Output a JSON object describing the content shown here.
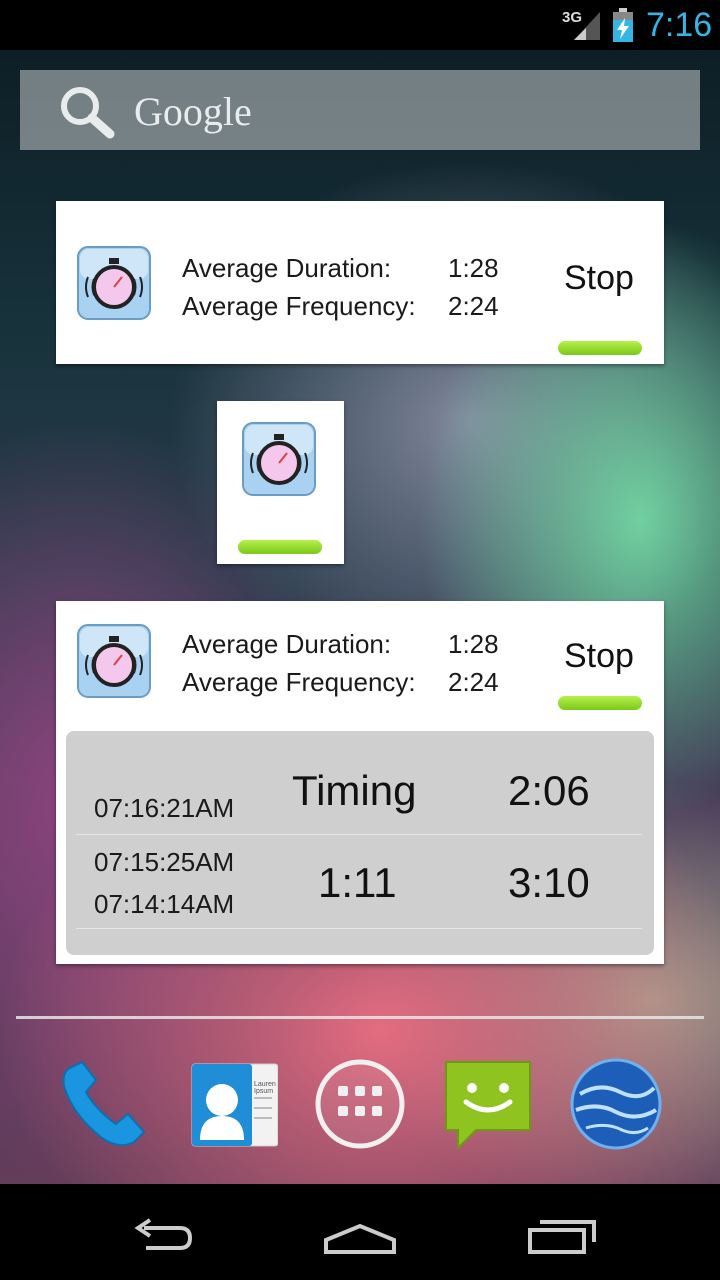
{
  "status_bar": {
    "network": "3G",
    "time": "7:16",
    "icons": [
      "signal-icon",
      "battery-charging-icon"
    ]
  },
  "search": {
    "label": "Google",
    "icon": "search-icon"
  },
  "widget_large": {
    "icon": "stopwatch-icon",
    "duration_label": "Average Duration:",
    "duration_value": "1:28",
    "frequency_label": "Average Frequency:",
    "frequency_value": "2:24",
    "stop_label": "Stop"
  },
  "widget_small": {
    "icon": "stopwatch-icon"
  },
  "widget_expanded": {
    "icon": "stopwatch-icon",
    "duration_label": "Average Duration:",
    "duration_value": "1:28",
    "frequency_label": "Average Frequency:",
    "frequency_value": "2:24",
    "stop_label": "Stop",
    "log": [
      {
        "time": "07:16:21AM",
        "duration": "Timing",
        "frequency": "2:06"
      },
      {
        "time_start": "07:15:25AM",
        "time_end": "07:14:14AM",
        "duration": "1:11",
        "frequency": "3:10"
      }
    ]
  },
  "dock": {
    "items": [
      "phone-icon",
      "contacts-icon",
      "app-drawer-icon",
      "messaging-icon",
      "browser-icon"
    ],
    "contacts_card_text": "Lauren Ipsum"
  },
  "nav": {
    "items": [
      "back-icon",
      "home-icon",
      "recent-apps-icon"
    ]
  },
  "colors": {
    "accent_clock": "#33b5e5",
    "progress_green": "#8fd62a"
  }
}
